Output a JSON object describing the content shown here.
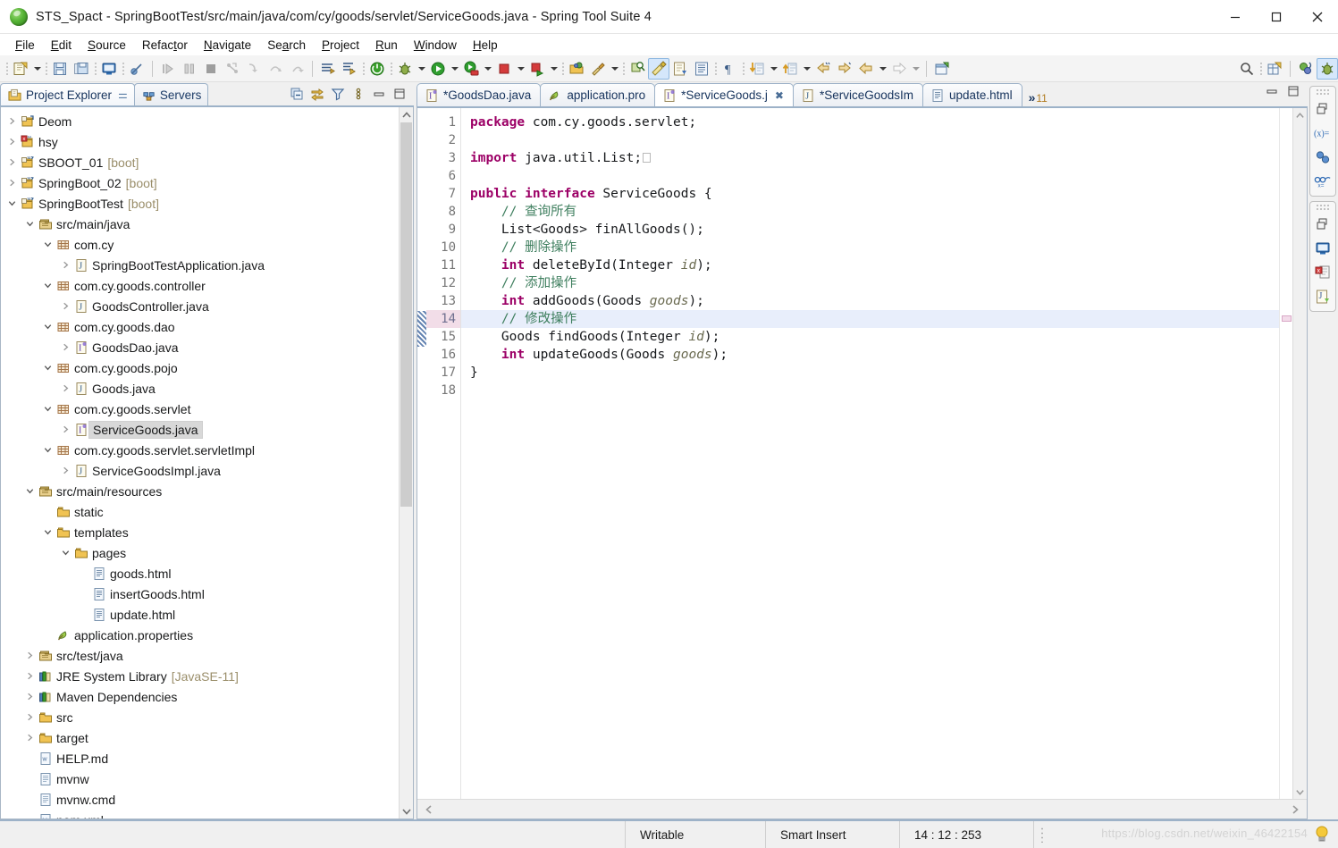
{
  "window": {
    "title": "STS_Spact - SpringBootTest/src/main/java/com/cy/goods/servlet/ServiceGoods.java - Spring Tool Suite 4",
    "logo_icon": "spring-leaf-icon",
    "minimize_label": "—",
    "maximize_label": "□",
    "close_label": "✕"
  },
  "menubar": {
    "items": [
      {
        "label": "File",
        "mnemonic": "F"
      },
      {
        "label": "Edit",
        "mnemonic": "E"
      },
      {
        "label": "Source",
        "mnemonic": "S"
      },
      {
        "label": "Refactor",
        "mnemonic": "t"
      },
      {
        "label": "Navigate",
        "mnemonic": "N"
      },
      {
        "label": "Search",
        "mnemonic": "a"
      },
      {
        "label": "Project",
        "mnemonic": "P"
      },
      {
        "label": "Run",
        "mnemonic": "R"
      },
      {
        "label": "Window",
        "mnemonic": "W"
      },
      {
        "label": "Help",
        "mnemonic": "H"
      }
    ]
  },
  "toolbar": {
    "items": [
      "new-wizard-icon",
      "new-dropdown-arrow",
      "save-icon",
      "save-all-icon",
      "open-console-icon",
      "toggle-breakpoint-icon",
      "resume-icon",
      "suspend-icon",
      "terminate-icon",
      "disconnect-icon",
      "step-into-icon",
      "step-over-icon",
      "step-return-icon",
      "skip-breakpoints-icon",
      "boot-dashboard-icon",
      "spring-boot-icon",
      "debug-icon",
      "debug-dropdown-arrow",
      "run-icon",
      "run-dropdown-arrow",
      "run-server-icon",
      "run-server-dropdown-arrow",
      "stop-icon",
      "stop-dropdown-arrow",
      "run-as-server-icon",
      "run-as-dropdown-arrow",
      "open-type-icon",
      "external-tools-icon",
      "external-tools-dropdown-arrow",
      "search-type-icon",
      "java-perspective-icon",
      "new-java-class-icon",
      "outline-icon",
      "pilcrow-icon",
      "next-annotation-icon",
      "next-annotation-dropdown-arrow",
      "previous-annotation-icon",
      "previous-annotation-dropdown-arrow",
      "back-history-icon",
      "forward-history-icon",
      "back-nav-icon",
      "back-nav-dropdown-arrow",
      "forward-nav-icon",
      "forward-nav-dropdown-arrow",
      "new-window-icon",
      "search-icon",
      "new-table-icon",
      "spring-perspective-icon",
      "debug-perspective-icon"
    ]
  },
  "left_pane": {
    "tabs": [
      {
        "label": "Project Explorer",
        "icon": "project-explorer-icon",
        "active": true,
        "closeable": true
      },
      {
        "label": "Servers",
        "icon": "servers-icon",
        "active": false,
        "closeable": false
      }
    ],
    "view_tools": [
      "collapse-all-icon",
      "link-with-editor-icon",
      "filter-icon",
      "view-menu-icon",
      "minimize-view-icon",
      "maximize-view-icon"
    ],
    "tree": [
      {
        "indent": 0,
        "twisty": "collapsed",
        "icon": "java-project-icon",
        "label": "Deom",
        "suffix": ""
      },
      {
        "indent": 0,
        "twisty": "collapsed",
        "icon": "maven-error-project-icon",
        "label": "hsy",
        "suffix": ""
      },
      {
        "indent": 0,
        "twisty": "collapsed",
        "icon": "boot-project-icon",
        "label": "SBOOT_01",
        "suffix": "[boot]"
      },
      {
        "indent": 0,
        "twisty": "collapsed",
        "icon": "boot-project-icon",
        "label": "SpringBoot_02",
        "suffix": "[boot]"
      },
      {
        "indent": 0,
        "twisty": "expanded",
        "icon": "boot-project-icon",
        "label": "SpringBootTest",
        "suffix": "[boot]"
      },
      {
        "indent": 1,
        "twisty": "expanded",
        "icon": "source-folder-icon",
        "label": "src/main/java",
        "suffix": ""
      },
      {
        "indent": 2,
        "twisty": "expanded",
        "icon": "package-icon",
        "label": "com.cy",
        "suffix": ""
      },
      {
        "indent": 3,
        "twisty": "collapsed",
        "icon": "java-class-icon",
        "label": "SpringBootTestApplication.java",
        "suffix": ""
      },
      {
        "indent": 2,
        "twisty": "expanded",
        "icon": "package-icon",
        "label": "com.cy.goods.controller",
        "suffix": ""
      },
      {
        "indent": 3,
        "twisty": "collapsed",
        "icon": "java-class-icon",
        "label": "GoodsController.java",
        "suffix": ""
      },
      {
        "indent": 2,
        "twisty": "expanded",
        "icon": "package-icon",
        "label": "com.cy.goods.dao",
        "suffix": ""
      },
      {
        "indent": 3,
        "twisty": "collapsed",
        "icon": "java-interface-icon",
        "label": "GoodsDao.java",
        "suffix": ""
      },
      {
        "indent": 2,
        "twisty": "expanded",
        "icon": "package-icon",
        "label": "com.cy.goods.pojo",
        "suffix": ""
      },
      {
        "indent": 3,
        "twisty": "collapsed",
        "icon": "java-class-icon",
        "label": "Goods.java",
        "suffix": ""
      },
      {
        "indent": 2,
        "twisty": "expanded",
        "icon": "package-icon",
        "label": "com.cy.goods.servlet",
        "suffix": ""
      },
      {
        "indent": 3,
        "twisty": "collapsed",
        "icon": "java-interface-icon",
        "label": "ServiceGoods.java",
        "suffix": "",
        "selected": true
      },
      {
        "indent": 2,
        "twisty": "expanded",
        "icon": "package-icon",
        "label": "com.cy.goods.servlet.servletImpl",
        "suffix": ""
      },
      {
        "indent": 3,
        "twisty": "collapsed",
        "icon": "java-class-icon",
        "label": "ServiceGoodsImpl.java",
        "suffix": ""
      },
      {
        "indent": 1,
        "twisty": "expanded",
        "icon": "source-folder-icon",
        "label": "src/main/resources",
        "suffix": ""
      },
      {
        "indent": 2,
        "twisty": "none",
        "icon": "folder-icon",
        "label": "static",
        "suffix": ""
      },
      {
        "indent": 2,
        "twisty": "expanded",
        "icon": "folder-icon",
        "label": "templates",
        "suffix": ""
      },
      {
        "indent": 3,
        "twisty": "expanded",
        "icon": "folder-icon",
        "label": "pages",
        "suffix": ""
      },
      {
        "indent": 4,
        "twisty": "none",
        "icon": "html-file-icon",
        "label": "goods.html",
        "suffix": ""
      },
      {
        "indent": 4,
        "twisty": "none",
        "icon": "html-file-icon",
        "label": "insertGoods.html",
        "suffix": ""
      },
      {
        "indent": 4,
        "twisty": "none",
        "icon": "html-file-icon",
        "label": "update.html",
        "suffix": ""
      },
      {
        "indent": 2,
        "twisty": "none",
        "icon": "properties-file-icon",
        "label": "application.properties",
        "suffix": ""
      },
      {
        "indent": 1,
        "twisty": "collapsed",
        "icon": "source-folder-icon",
        "label": "src/test/java",
        "suffix": ""
      },
      {
        "indent": 1,
        "twisty": "collapsed",
        "icon": "library-icon",
        "label": "JRE System Library",
        "suffix": "[JavaSE-11]"
      },
      {
        "indent": 1,
        "twisty": "collapsed",
        "icon": "library-icon",
        "label": "Maven Dependencies",
        "suffix": ""
      },
      {
        "indent": 1,
        "twisty": "collapsed",
        "icon": "folder-icon",
        "label": "src",
        "suffix": ""
      },
      {
        "indent": 1,
        "twisty": "collapsed",
        "icon": "folder-icon",
        "label": "target",
        "suffix": ""
      },
      {
        "indent": 1,
        "twisty": "none",
        "icon": "markdown-file-icon",
        "label": "HELP.md",
        "suffix": ""
      },
      {
        "indent": 1,
        "twisty": "none",
        "icon": "file-icon",
        "label": "mvnw",
        "suffix": ""
      },
      {
        "indent": 1,
        "twisty": "none",
        "icon": "file-icon",
        "label": "mvnw.cmd",
        "suffix": ""
      },
      {
        "indent": 1,
        "twisty": "none",
        "icon": "xml-file-icon",
        "label": "pom.xml",
        "suffix": ""
      }
    ]
  },
  "editor": {
    "tabs": [
      {
        "label": "*GoodsDao.java",
        "icon": "java-interface-icon",
        "active": false,
        "dirty": true
      },
      {
        "label": "application.pro",
        "icon": "properties-file-icon",
        "active": false,
        "dirty": false
      },
      {
        "label": "*ServiceGoods.j",
        "icon": "java-interface-icon",
        "active": true,
        "dirty": true,
        "closeable": true
      },
      {
        "label": "*ServiceGoodsIm",
        "icon": "java-class-icon",
        "active": false,
        "dirty": true
      },
      {
        "label": "update.html",
        "icon": "html-file-icon",
        "active": false,
        "dirty": false
      }
    ],
    "overflow_chevron": "»",
    "overflow_count": "11",
    "tools": [
      "restore-editor-icon",
      "maximize-editor-icon"
    ],
    "lines": [
      {
        "num": "1",
        "fold": false,
        "highlight": false,
        "tokens": [
          {
            "t": "kw",
            "v": "package"
          },
          {
            "t": "pl",
            "v": " com.cy.goods.servlet;"
          }
        ]
      },
      {
        "num": "2",
        "fold": false,
        "highlight": false,
        "tokens": []
      },
      {
        "num": "3",
        "fold": true,
        "highlight": false,
        "tokens": [
          {
            "t": "kw",
            "v": "import"
          },
          {
            "t": "pl",
            "v": " java.util.List;"
          },
          {
            "t": "box",
            "v": ""
          }
        ]
      },
      {
        "num": "6",
        "fold": false,
        "highlight": false,
        "tokens": []
      },
      {
        "num": "7",
        "fold": false,
        "highlight": false,
        "tokens": [
          {
            "t": "kw",
            "v": "public interface"
          },
          {
            "t": "pl",
            "v": " ServiceGoods {"
          }
        ]
      },
      {
        "num": "8",
        "fold": false,
        "highlight": false,
        "tokens": [
          {
            "t": "cm",
            "v": "    // 查询所有"
          }
        ]
      },
      {
        "num": "9",
        "fold": false,
        "highlight": false,
        "tokens": [
          {
            "t": "pl",
            "v": "    List<Goods> finAllGoods();"
          }
        ]
      },
      {
        "num": "10",
        "fold": false,
        "highlight": false,
        "tokens": [
          {
            "t": "cm",
            "v": "    // 删除操作"
          }
        ]
      },
      {
        "num": "11",
        "fold": false,
        "highlight": false,
        "tokens": [
          {
            "t": "kw",
            "v": "    int"
          },
          {
            "t": "pl",
            "v": " deleteById(Integer "
          },
          {
            "t": "pm",
            "v": "id"
          },
          {
            "t": "pl",
            "v": ");"
          }
        ]
      },
      {
        "num": "12",
        "fold": false,
        "highlight": false,
        "tokens": [
          {
            "t": "cm",
            "v": "    // 添加操作"
          }
        ]
      },
      {
        "num": "13",
        "fold": false,
        "highlight": false,
        "tokens": [
          {
            "t": "kw",
            "v": "    int"
          },
          {
            "t": "pl",
            "v": " addGoods(Goods "
          },
          {
            "t": "pm",
            "v": "goods"
          },
          {
            "t": "pl",
            "v": ");"
          }
        ]
      },
      {
        "num": "14",
        "fold": false,
        "highlight": true,
        "tokens": [
          {
            "t": "cm",
            "v": "    // 修改操作"
          }
        ]
      },
      {
        "num": "15",
        "fold": false,
        "highlight": false,
        "tokens": [
          {
            "t": "pl",
            "v": "    Goods findGoods(Integer "
          },
          {
            "t": "pm",
            "v": "id"
          },
          {
            "t": "pl",
            "v": ");"
          }
        ]
      },
      {
        "num": "16",
        "fold": false,
        "highlight": false,
        "tokens": [
          {
            "t": "kw",
            "v": "    int"
          },
          {
            "t": "pl",
            "v": " updateGoods(Goods "
          },
          {
            "t": "pm",
            "v": "goods"
          },
          {
            "t": "pl",
            "v": ");"
          }
        ]
      },
      {
        "num": "17",
        "fold": false,
        "highlight": false,
        "tokens": [
          {
            "t": "pl",
            "v": "}"
          }
        ]
      },
      {
        "num": "18",
        "fold": false,
        "highlight": false,
        "tokens": []
      }
    ]
  },
  "fastview": {
    "groups": [
      {
        "handle": "drag-handle",
        "items": [
          "restore-view-icon",
          "variables-view-icon",
          "breakpoints-view-icon",
          "expressions-view-icon"
        ]
      },
      {
        "handle": "drag-handle",
        "items": [
          "restore-view-icon",
          "console-view-icon",
          "problems-view-icon",
          "javadoc-view-icon"
        ]
      }
    ]
  },
  "statusbar": {
    "writable": "Writable",
    "insert_mode": "Smart Insert",
    "position": "14 : 12 : 253",
    "watermark": "https://blog.csdn.net/weixin_46422154",
    "bulb_icon": "tip-bulb-icon"
  },
  "colors": {
    "keyword": "#9c0066",
    "comment": "#3f7f5f",
    "param": "#6a6a50",
    "plain": "#17191c",
    "highlight_line": "#e8eefb",
    "gutter_highlight": "#f2dde8",
    "tab_border": "#9db2c8",
    "selection": "#d8d8d8",
    "accent": "#2f7d1c"
  }
}
